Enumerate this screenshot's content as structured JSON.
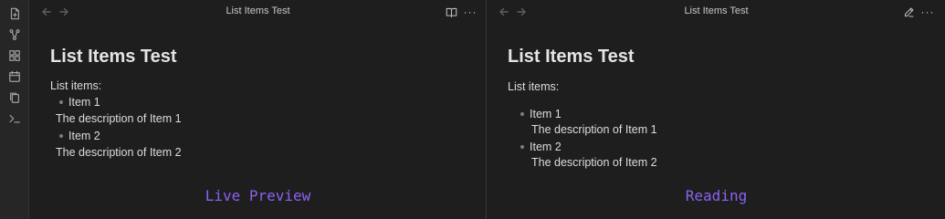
{
  "ribbon": {
    "icons": [
      "file-open-icon",
      "graph-icon",
      "blocks-icon",
      "calendar-icon",
      "copy-icon",
      "terminal-icon"
    ]
  },
  "panes": {
    "left": {
      "title": "List Items Test",
      "action_icon": "book-open-icon",
      "more_label": "···",
      "heading": "List Items Test",
      "intro": "List items:",
      "items": [
        {
          "label": "Item 1",
          "description": "The description of Item 1"
        },
        {
          "label": "Item 2",
          "description": "The description of Item 2"
        }
      ],
      "caption": "Live Preview"
    },
    "right": {
      "title": "List Items Test",
      "action_icon": "pencil-icon",
      "more_label": "···",
      "heading": "List Items Test",
      "intro": "List items:",
      "items": [
        {
          "label": "Item 1",
          "description": "The description of Item 1"
        },
        {
          "label": "Item 2",
          "description": "The description of Item 2"
        }
      ],
      "caption": "Reading"
    }
  },
  "colors": {
    "background": "#1e1e1e",
    "ribbon": "#262626",
    "caption": "#8b62f0",
    "text": "#dcdcdc"
  }
}
